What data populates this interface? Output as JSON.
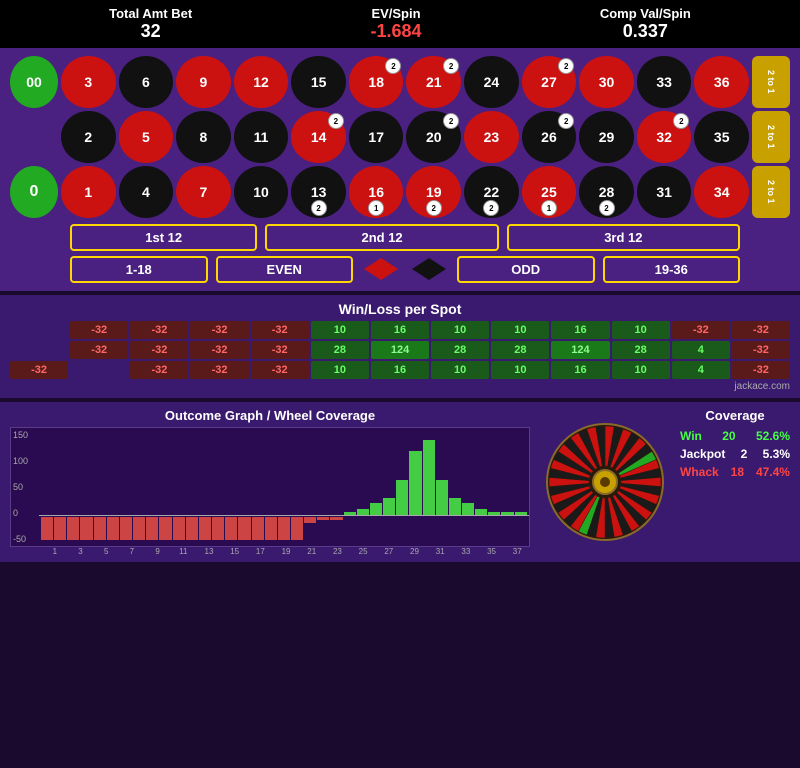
{
  "stats": {
    "total_amt_label": "Total Amt Bet",
    "total_amt_value": "32",
    "ev_spin_label": "EV/Spin",
    "ev_spin_value": "-1.684",
    "comp_val_label": "Comp Val/Spin",
    "comp_val_value": "0.337"
  },
  "table": {
    "zero": "0",
    "double_zero": "00",
    "two_to_one": "2 to 1",
    "numbers": [
      {
        "val": "3",
        "color": "red"
      },
      {
        "val": "6",
        "color": "black"
      },
      {
        "val": "9",
        "color": "red"
      },
      {
        "val": "12",
        "color": "red"
      },
      {
        "val": "15",
        "color": "black"
      },
      {
        "val": "18",
        "color": "red"
      },
      {
        "val": "21",
        "color": "red"
      },
      {
        "val": "24",
        "color": "black"
      },
      {
        "val": "27",
        "color": "red"
      },
      {
        "val": "30",
        "color": "red"
      },
      {
        "val": "33",
        "color": "black"
      },
      {
        "val": "36",
        "color": "red"
      },
      {
        "val": "2",
        "color": "black"
      },
      {
        "val": "5",
        "color": "red"
      },
      {
        "val": "8",
        "color": "black"
      },
      {
        "val": "11",
        "color": "black"
      },
      {
        "val": "14",
        "color": "red"
      },
      {
        "val": "17",
        "color": "black"
      },
      {
        "val": "20",
        "color": "black"
      },
      {
        "val": "23",
        "color": "red"
      },
      {
        "val": "26",
        "color": "black"
      },
      {
        "val": "29",
        "color": "black"
      },
      {
        "val": "32",
        "color": "red"
      },
      {
        "val": "35",
        "color": "black"
      },
      {
        "val": "1",
        "color": "red"
      },
      {
        "val": "4",
        "color": "black"
      },
      {
        "val": "7",
        "color": "red"
      },
      {
        "val": "10",
        "color": "black"
      },
      {
        "val": "13",
        "color": "black"
      },
      {
        "val": "16",
        "color": "red"
      },
      {
        "val": "19",
        "color": "red"
      },
      {
        "val": "22",
        "color": "black"
      },
      {
        "val": "25",
        "color": "red"
      },
      {
        "val": "28",
        "color": "black"
      },
      {
        "val": "31",
        "color": "black"
      },
      {
        "val": "34",
        "color": "red"
      }
    ],
    "dozen1": "1st 12",
    "dozen2": "2nd 12",
    "dozen3": "3rd 12",
    "bet118": "1-18",
    "even": "EVEN",
    "odd": "ODD",
    "bet1936": "19-36"
  },
  "winloss": {
    "title": "Win/Loss per Spot",
    "rows": [
      [
        "-32",
        "-32",
        "-32",
        "-32",
        "-32",
        "10",
        "16",
        "10",
        "10",
        "16",
        "10",
        "-32",
        "-32"
      ],
      [
        "",
        "-32",
        "-32",
        "-32",
        "-32",
        "28",
        "124",
        "28",
        "28",
        "124",
        "28",
        "4",
        "-32"
      ],
      [
        "-32",
        "",
        "-32",
        "-32",
        "-32",
        "-32",
        "10",
        "16",
        "10",
        "10",
        "16",
        "10",
        "4",
        "-32"
      ]
    ]
  },
  "outcome": {
    "title": "Outcome Graph / Wheel Coverage",
    "y_labels": [
      "150",
      "100",
      "50",
      "0",
      "-50"
    ],
    "x_labels": [
      "1",
      "3",
      "5",
      "7",
      "9",
      "11",
      "13",
      "15",
      "17",
      "19",
      "21",
      "23",
      "25",
      "27",
      "29",
      "31",
      "33",
      "35",
      "37"
    ],
    "bars": [
      {
        "val": -40
      },
      {
        "val": -40
      },
      {
        "val": -40
      },
      {
        "val": -40
      },
      {
        "val": -40
      },
      {
        "val": -40
      },
      {
        "val": -40
      },
      {
        "val": -40
      },
      {
        "val": -40
      },
      {
        "val": -40
      },
      {
        "val": -40
      },
      {
        "val": -40
      },
      {
        "val": -40
      },
      {
        "val": -40
      },
      {
        "val": -40
      },
      {
        "val": -40
      },
      {
        "val": -40
      },
      {
        "val": -40
      },
      {
        "val": -40
      },
      {
        "val": -40
      },
      {
        "val": -10
      },
      {
        "val": -5
      },
      {
        "val": -5
      },
      {
        "val": 5
      },
      {
        "val": 10
      },
      {
        "val": 20
      },
      {
        "val": 30
      },
      {
        "val": 60
      },
      {
        "val": 110
      },
      {
        "val": 130
      },
      {
        "val": 60
      },
      {
        "val": 30
      },
      {
        "val": 20
      },
      {
        "val": 10
      },
      {
        "val": 5
      },
      {
        "val": 5
      },
      {
        "val": 5
      }
    ]
  },
  "coverage": {
    "title": "Coverage",
    "win_label": "Win",
    "win_count": "20",
    "win_pct": "52.6%",
    "jackpot_label": "Jackpot",
    "jackpot_count": "2",
    "jackpot_pct": "5.3%",
    "whack_label": "Whack",
    "whack_count": "18",
    "whack_pct": "47.4%"
  },
  "jackace": "jackace.com"
}
